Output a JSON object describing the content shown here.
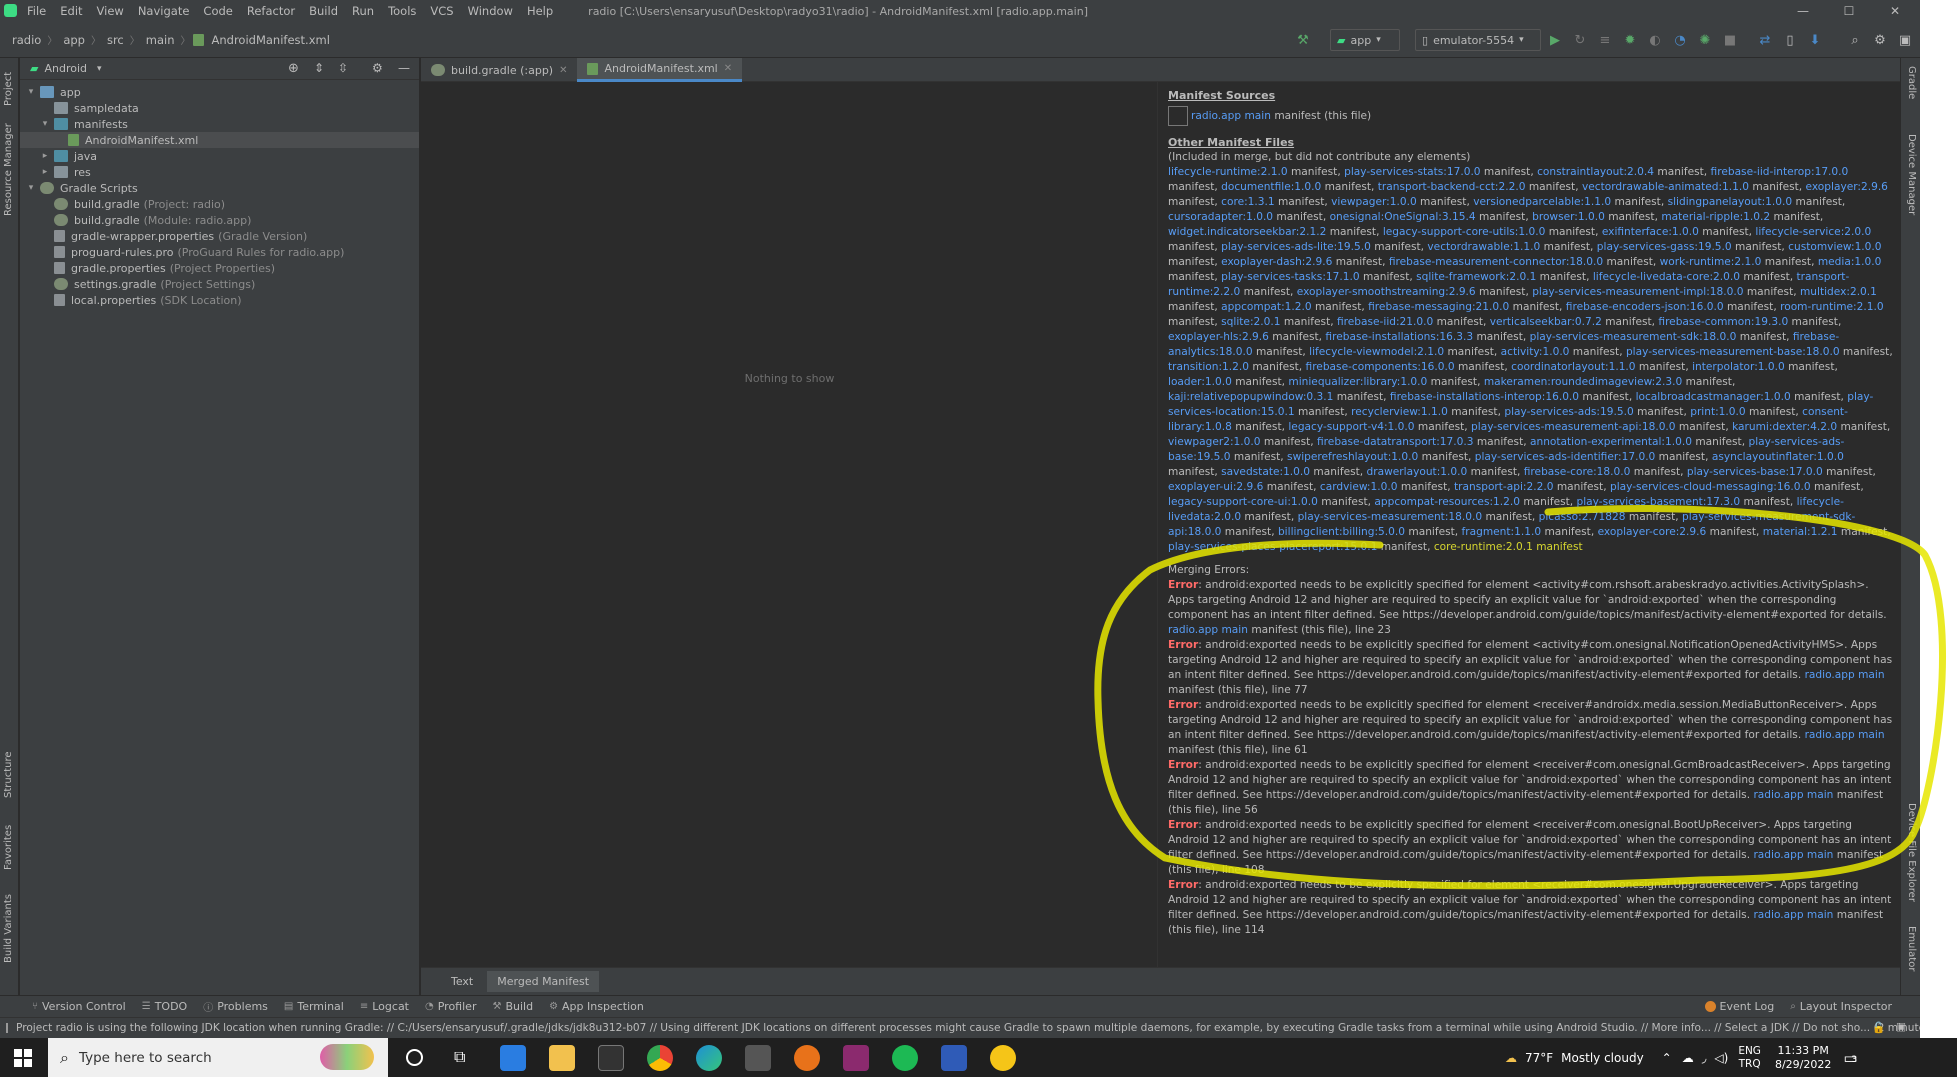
{
  "window": {
    "menu": [
      "File",
      "Edit",
      "View",
      "Navigate",
      "Code",
      "Refactor",
      "Build",
      "Run",
      "Tools",
      "VCS",
      "Window",
      "Help"
    ],
    "title": "radio [C:\\Users\\ensaryusuf\\Desktop\\radyo31\\radio] - AndroidManifest.xml [radio.app.main]",
    "controls": {
      "minimize": "—",
      "maximize": "☐",
      "close": "✕"
    }
  },
  "breadcrumb": [
    "radio",
    "app",
    "src",
    "main",
    "AndroidManifest.xml"
  ],
  "toolbar": {
    "run_config": "app",
    "device": "emulator-5554"
  },
  "left_strip": {
    "top": [
      "Project",
      "Resource Manager"
    ],
    "bottom": [
      "Structure",
      "Favorites",
      "Build Variants"
    ]
  },
  "right_strip": [
    "Gradle",
    "Device Manager",
    "Device File Explorer",
    "Emulator"
  ],
  "project_panel": {
    "view": "Android",
    "tree": [
      {
        "label": "app",
        "hint": "",
        "level": 0,
        "arrow": "▾",
        "icon": "folder blue",
        "selected": false
      },
      {
        "label": "sampledata",
        "hint": "",
        "level": 1,
        "arrow": "",
        "icon": "folder",
        "selected": false
      },
      {
        "label": "manifests",
        "hint": "",
        "level": 1,
        "arrow": "▾",
        "icon": "folder teal",
        "selected": false
      },
      {
        "label": "AndroidManifest.xml",
        "hint": "",
        "level": 2,
        "arrow": "",
        "icon": "xml",
        "selected": true
      },
      {
        "label": "java",
        "hint": "",
        "level": 1,
        "arrow": "▸",
        "icon": "folder teal",
        "selected": false
      },
      {
        "label": "res",
        "hint": "",
        "level": 1,
        "arrow": "▸",
        "icon": "folder",
        "selected": false
      },
      {
        "label": "Gradle Scripts",
        "hint": "",
        "level": 0,
        "arrow": "▾",
        "icon": "gradle",
        "selected": false
      },
      {
        "label": "build.gradle",
        "hint": "(Project: radio)",
        "level": 1,
        "arrow": "",
        "icon": "gradle",
        "selected": false
      },
      {
        "label": "build.gradle",
        "hint": "(Module: radio.app)",
        "level": 1,
        "arrow": "",
        "icon": "gradle",
        "selected": false
      },
      {
        "label": "gradle-wrapper.properties",
        "hint": "(Gradle Version)",
        "level": 1,
        "arrow": "",
        "icon": "file",
        "selected": false
      },
      {
        "label": "proguard-rules.pro",
        "hint": "(ProGuard Rules for radio.app)",
        "level": 1,
        "arrow": "",
        "icon": "file",
        "selected": false
      },
      {
        "label": "gradle.properties",
        "hint": "(Project Properties)",
        "level": 1,
        "arrow": "",
        "icon": "file",
        "selected": false
      },
      {
        "label": "settings.gradle",
        "hint": "(Project Settings)",
        "level": 1,
        "arrow": "",
        "icon": "gradle",
        "selected": false
      },
      {
        "label": "local.properties",
        "hint": "(SDK Location)",
        "level": 1,
        "arrow": "",
        "icon": "file",
        "selected": false
      }
    ]
  },
  "editor_tabs": [
    {
      "label": "build.gradle (:app)",
      "active": false
    },
    {
      "label": "AndroidManifest.xml",
      "active": true
    }
  ],
  "editor": {
    "empty_text": "Nothing to show"
  },
  "manifest": {
    "sources_heading": "Manifest Sources",
    "source_link": "radio.app main",
    "source_suffix": " manifest (this file)",
    "other_heading": "Other Manifest Files",
    "other_note": "(Included in merge, but did not contribute any elements)",
    "libraries": [
      "lifecycle-runtime:2.1.0",
      "play-services-stats:17.0.0",
      "constraintlayout:2.0.4",
      "firebase-iid-interop:17.0.0",
      "documentfile:1.0.0",
      "transport-backend-cct:2.2.0",
      "vectordrawable-animated:1.1.0",
      "exoplayer:2.9.6",
      "core:1.3.1",
      "viewpager:1.0.0",
      "versionedparcelable:1.1.0",
      "slidingpanelayout:1.0.0",
      "cursoradapter:1.0.0",
      "onesignal:OneSignal:3.15.4",
      "browser:1.0.0",
      "material-ripple:1.0.2",
      "widget.indicatorseekbar:2.1.2",
      "legacy-support-core-utils:1.0.0",
      "exifinterface:1.0.0",
      "lifecycle-service:2.0.0",
      "play-services-ads-lite:19.5.0",
      "vectordrawable:1.1.0",
      "play-services-gass:19.5.0",
      "customview:1.0.0",
      "exoplayer-dash:2.9.6",
      "firebase-measurement-connector:18.0.0",
      "work-runtime:2.1.0",
      "media:1.0.0",
      "play-services-tasks:17.1.0",
      "sqlite-framework:2.0.1",
      "lifecycle-livedata-core:2.0.0",
      "transport-runtime:2.2.0",
      "exoplayer-smoothstreaming:2.9.6",
      "play-services-measurement-impl:18.0.0",
      "multidex:2.0.1",
      "appcompat:1.2.0",
      "firebase-messaging:21.0.0",
      "firebase-encoders-json:16.0.0",
      "room-runtime:2.1.0",
      "sqlite:2.0.1",
      "firebase-iid:21.0.0",
      "verticalseekbar:0.7.2",
      "firebase-common:19.3.0",
      "exoplayer-hls:2.9.6",
      "firebase-installations:16.3.3",
      "play-services-measurement-sdk:18.0.0",
      "firebase-analytics:18.0.0",
      "lifecycle-viewmodel:2.1.0",
      "activity:1.0.0",
      "play-services-measurement-base:18.0.0",
      "transition:1.2.0",
      "firebase-components:16.0.0",
      "coordinatorlayout:1.1.0",
      "interpolator:1.0.0",
      "loader:1.0.0",
      "miniequalizer:library:1.0.0",
      "makeramen:roundedimageview:2.3.0",
      "kaji:relativepopupwindow:0.3.1",
      "firebase-installations-interop:16.0.0",
      "localbroadcastmanager:1.0.0",
      "play-services-location:15.0.1",
      "recyclerview:1.1.0",
      "play-services-ads:19.5.0",
      "print:1.0.0",
      "consent-library:1.0.8",
      "legacy-support-v4:1.0.0",
      "play-services-measurement-api:18.0.0",
      "karumi:dexter:4.2.0",
      "viewpager2:1.0.0",
      "firebase-datatransport:17.0.3",
      "annotation-experimental:1.0.0",
      "play-services-ads-base:19.5.0",
      "swiperefreshlayout:1.0.0",
      "play-services-ads-identifier:17.0.0",
      "asynclayoutinflater:1.0.0",
      "savedstate:1.0.0",
      "drawerlayout:1.0.0",
      "firebase-core:18.0.0",
      "play-services-base:17.0.0",
      "exoplayer-ui:2.9.6",
      "cardview:1.0.0",
      "transport-api:2.2.0",
      "play-services-cloud-messaging:16.0.0",
      "legacy-support-core-ui:1.0.0",
      "appcompat-resources:1.2.0",
      "play-services-basement:17.3.0",
      "lifecycle-livedata:2.0.0",
      "play-services-measurement:18.0.0",
      "picasso:2.71828",
      "play-services-measurement-sdk-api:18.0.0",
      "billingclient:billing:5.0.0",
      "fragment:1.1.0",
      "exoplayer-core:2.9.6",
      "material:1.2.1",
      "play-services-places-placereport:15.0.1",
      "core-runtime:2.0.1"
    ],
    "lib_suffix": " manifest",
    "errors_heading": "Merging Errors:",
    "errors": [
      {
        "label": "Error",
        "text": ": android:exported needs to be explicitly specified for element <activity#com.rshsoft.arabeskradyo.activities.ActivitySplash>. Apps targeting Android 12 and higher are required to specify an explicit value for `android:exported` when the corresponding component has an intent filter defined. See https://developer.android.com/guide/topics/manifest/activity-element#exported for details. ",
        "link": "radio.app main",
        "suffix": " manifest (this file), line 23"
      },
      {
        "label": "Error",
        "text": ": android:exported needs to be explicitly specified for element <activity#com.onesignal.NotificationOpenedActivityHMS>. Apps targeting Android 12 and higher are required to specify an explicit value for `android:exported` when the corresponding component has an intent filter defined. See https://developer.android.com/guide/topics/manifest/activity-element#exported for details. ",
        "link": "radio.app main",
        "suffix": " manifest (this file), line 77"
      },
      {
        "label": "Error",
        "text": ": android:exported needs to be explicitly specified for element <receiver#androidx.media.session.MediaButtonReceiver>. Apps targeting Android 12 and higher are required to specify an explicit value for `android:exported` when the corresponding component has an intent filter defined. See https://developer.android.com/guide/topics/manifest/activity-element#exported for details. ",
        "link": "radio.app main",
        "suffix": " manifest (this file), line 61"
      },
      {
        "label": "Error",
        "text": ": android:exported needs to be explicitly specified for element <receiver#com.onesignal.GcmBroadcastReceiver>. Apps targeting Android 12 and higher are required to specify an explicit value for `android:exported` when the corresponding component has an intent filter defined. See https://developer.android.com/guide/topics/manifest/activity-element#exported for details. ",
        "link": "radio.app main",
        "suffix": " manifest (this file), line 56"
      },
      {
        "label": "Error",
        "text": ": android:exported needs to be explicitly specified for element <receiver#com.onesignal.BootUpReceiver>. Apps targeting Android 12 and higher are required to specify an explicit value for `android:exported` when the corresponding component has an intent filter defined. See https://developer.android.com/guide/topics/manifest/activity-element#exported for details. ",
        "link": "radio.app main",
        "suffix": " manifest (this file), line 108"
      },
      {
        "label": "Error",
        "text": ": android:exported needs to be explicitly specified for element <receiver#com.onesignal.UpgradeReceiver>. Apps targeting Android 12 and higher are required to specify an explicit value for `android:exported` when the corresponding component has an intent filter defined. See https://developer.android.com/guide/topics/manifest/activity-element#exported for details. ",
        "link": "radio.app main",
        "suffix": " manifest (this file), line 114"
      }
    ]
  },
  "bottom_editor_tabs": [
    {
      "label": "Text",
      "active": false
    },
    {
      "label": "Merged Manifest",
      "active": true
    }
  ],
  "tool_windows": {
    "left": [
      "Version Control",
      "TODO",
      "Problems",
      "Terminal",
      "Logcat",
      "Profiler",
      "Build",
      "App Inspection"
    ],
    "right": [
      "Event Log",
      "Layout Inspector"
    ]
  },
  "status": "Project radio is using the following JDK location when running Gradle: // C:/Users/ensaryusuf/.gradle/jdks/jdk8u312-b07 // Using different JDK locations on different processes might cause Gradle to spawn multiple daemons, for example, by executing Gradle tasks from a terminal while using Android Studio. // More info... // Select a JDK // Do not sho... (2 minutes ago)",
  "taskbar": {
    "search_placeholder": "Type here to search",
    "weather_temp": "77°F",
    "weather_text": "Mostly cloudy",
    "lang": "ENG",
    "lang2": "TRQ",
    "time": "11:33 PM",
    "date": "8/29/2022",
    "notif_count": "3"
  },
  "colors": {
    "ide_bg": "#2b2b2b",
    "panel_bg": "#3c3f41",
    "link": "#589df6",
    "error": "#ff6b68",
    "annotation": "#e8e800"
  }
}
